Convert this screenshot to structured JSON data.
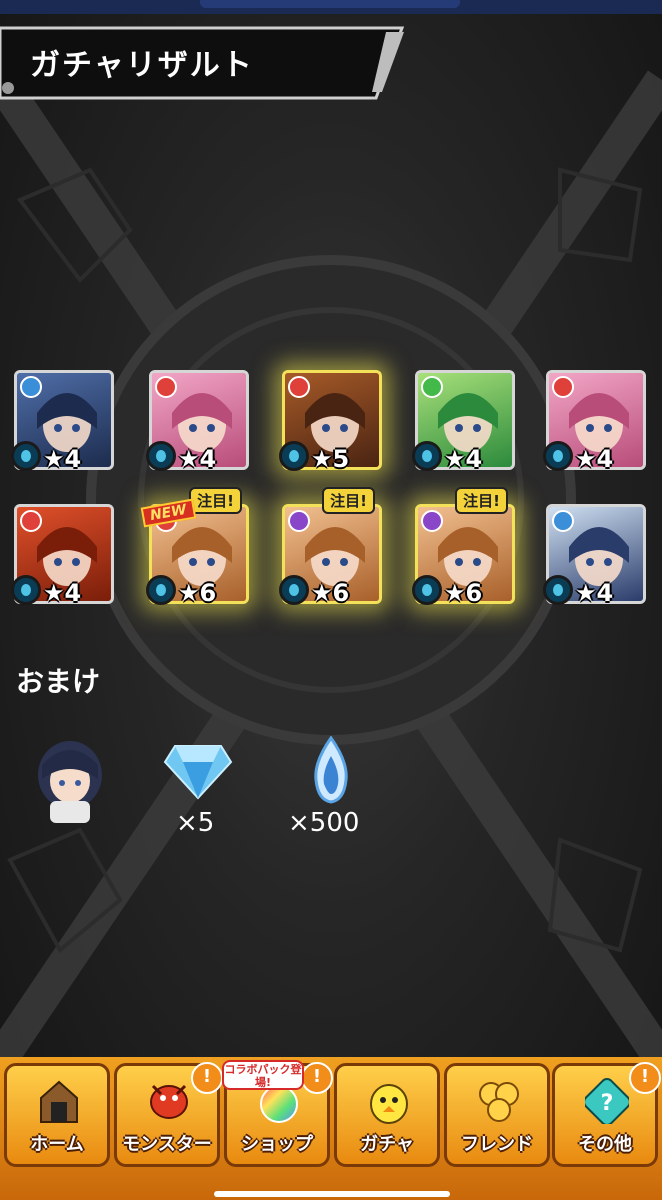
{
  "header": {
    "title": "ガチャリザルト"
  },
  "results": [
    {
      "stars": "★4",
      "element": "water",
      "color": "#3a8fd8",
      "highlight": false,
      "tag": "",
      "new": ""
    },
    {
      "stars": "★4",
      "element": "fire",
      "color": "#e0403a",
      "highlight": false,
      "tag": "",
      "new": ""
    },
    {
      "stars": "★5",
      "element": "fire",
      "color": "#e0403a",
      "highlight": true,
      "tag": "",
      "new": ""
    },
    {
      "stars": "★4",
      "element": "wood",
      "color": "#43b94a",
      "highlight": false,
      "tag": "",
      "new": ""
    },
    {
      "stars": "★4",
      "element": "fire",
      "color": "#e0403a",
      "highlight": false,
      "tag": "",
      "new": ""
    },
    {
      "stars": "★4",
      "element": "fire",
      "color": "#e0403a",
      "highlight": false,
      "tag": "",
      "new": ""
    },
    {
      "stars": "★6",
      "element": "fire",
      "color": "#e0403a",
      "highlight": true,
      "tag": "注目!",
      "new": "NEW"
    },
    {
      "stars": "★6",
      "element": "dark",
      "color": "#8a46c8",
      "highlight": true,
      "tag": "注目!",
      "new": ""
    },
    {
      "stars": "★6",
      "element": "dark",
      "color": "#8a46c8",
      "highlight": true,
      "tag": "注目!",
      "new": ""
    },
    {
      "stars": "★4",
      "element": "water",
      "color": "#3a8fd8",
      "highlight": false,
      "tag": "",
      "new": ""
    }
  ],
  "bonus": {
    "title": "おまけ",
    "gem_count": "×5",
    "orb_count": "×500"
  },
  "nav": {
    "items": [
      {
        "label": "ホーム",
        "icon": "home-gate-icon",
        "badge": ""
      },
      {
        "label": "モンスター",
        "icon": "dragon-icon",
        "badge": "!"
      },
      {
        "label": "ショップ",
        "icon": "rainbow-orb-icon",
        "badge": "!"
      },
      {
        "label": "ガチャ",
        "icon": "chick-icon",
        "badge": ""
      },
      {
        "label": "フレンド",
        "icon": "balloons-icon",
        "badge": ""
      },
      {
        "label": "その他",
        "icon": "question-icon",
        "badge": "!"
      }
    ],
    "collab_notice": "コラボパック登場!"
  }
}
